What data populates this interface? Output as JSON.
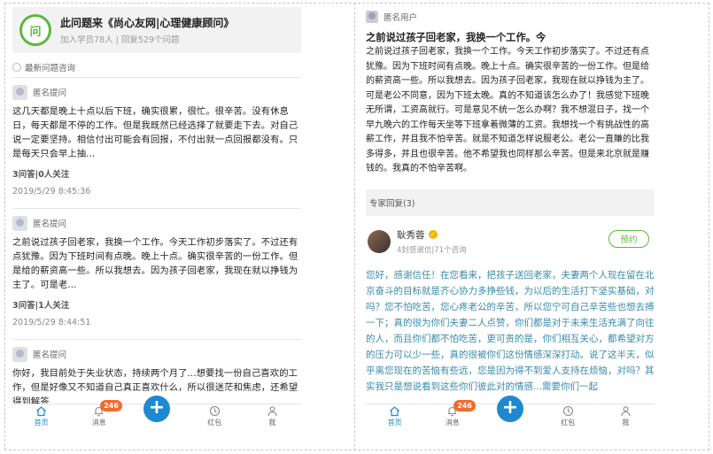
{
  "left": {
    "header": {
      "title": "此问题来《尚心友网|心理健康顾问》",
      "stats": "加入学员78人 | 回复529个问题",
      "logo_text": "问"
    },
    "section_label": "最新问题咨询",
    "questions": [
      {
        "asker": "匿名提问",
        "text": "这几天都是晚上十点以后下班，确实很累，很忙。很辛苦。没有休息日，每天都是不停的工作。但是我既然已经选择了就要走下去。对自己说一定要坚持。相信付出可能会有回报，不付出就一点回报都没有。只是每天只会早上抽...",
        "meta": "3问答|0人关注",
        "time": "2019/5/29 8:45:36"
      },
      {
        "asker": "匿名提问",
        "text": "之前说过孩子回老家，我换一个工作。今天工作初步落实了。不过还有点犹豫。因为下班时间有点晚。晚上十点。确实很辛苦的一份工作。但是给的薪资高一些。所以我想去。因为孩子回老家，我现在就以挣钱为主了。可是老...",
        "meta": "3问答|1人关注",
        "time": "2019/5/29 8:44:51"
      },
      {
        "asker": "匿名提问",
        "text": "你好，我目前处于失业状态，持续两个月了...想要找一份自己喜欢的工作，但是好像又不知道自己真正喜欢什么，所以很迷茫和焦虑，还希望得到解答"
      }
    ]
  },
  "right": {
    "asker": "匿名用户",
    "title": "之前说过孩子回老家，我换一个工作。今",
    "body": "之前说过孩子回老家，我换一个工作。今天工作初步落实了。不过还有点犹豫。因为下班时间有点晚。晚上十点。确实很辛苦的一份工作。但是给的薪资高一些。所以我想去。因为孩子回老家，我现在就以挣钱为主了。可是老公不同意，因为下班太晚。真的不知道该怎么办了！我感觉下班晚无所谓，工资高就行。可是意见不统一怎么办啊？我不想混日子，找一个早九晚六的工作每天坐等下班拿着微薄的工资。我想找一个有挑战性的高薪工作，并且我不怕辛苦。就是不知道怎样说服老公。老公一直賺的比我多得多，并且也很辛苦。他不希望我也同样那么辛苦。但是来北京就是赚钱的。我真的不怕辛苦啊。",
    "reply_count_label": "专家回复(3)",
    "expert": {
      "name": "耿秀蓉",
      "stats": "4封感谢信|71个咨询",
      "book_label": "预约"
    },
    "answer": "您好，感谢信任！在您看来，把孩子送回老家，夫妻两个人现在留在北京奋斗的目标就是齐心协力多挣些钱，为以后的生活打下坚实基础，对吗？您不怕吃苦，您心疼老公的辛苦，所以您宁可自己辛苦些也想去搏一下；真的很为你们夫妻二人点赞，你们都是对于未来生活充满了向往的人，而且你们都不怕吃苦，更可贵的是，你们相互关心，都希望对方的压力可以少一些，真的很被你们这份情感深深打动。说了这半天，似乎离您现在的苦恼有些远，您是因为得不到爱人支持在烦恼，对吗？其实我只是想说看到这些你们彼此对的情感...需要你们一起"
  },
  "tabbar": {
    "home_label": "首页",
    "messages_label": "消息",
    "messages_badge": "246",
    "plus_label": "+",
    "redpacket_label": "红包",
    "me_label": "我",
    "active_color": "#1e88d2",
    "badge_color": "#f26a2e"
  },
  "colors": {
    "brand_green": "#5fb640",
    "answer_text": "#3a8aa9"
  }
}
